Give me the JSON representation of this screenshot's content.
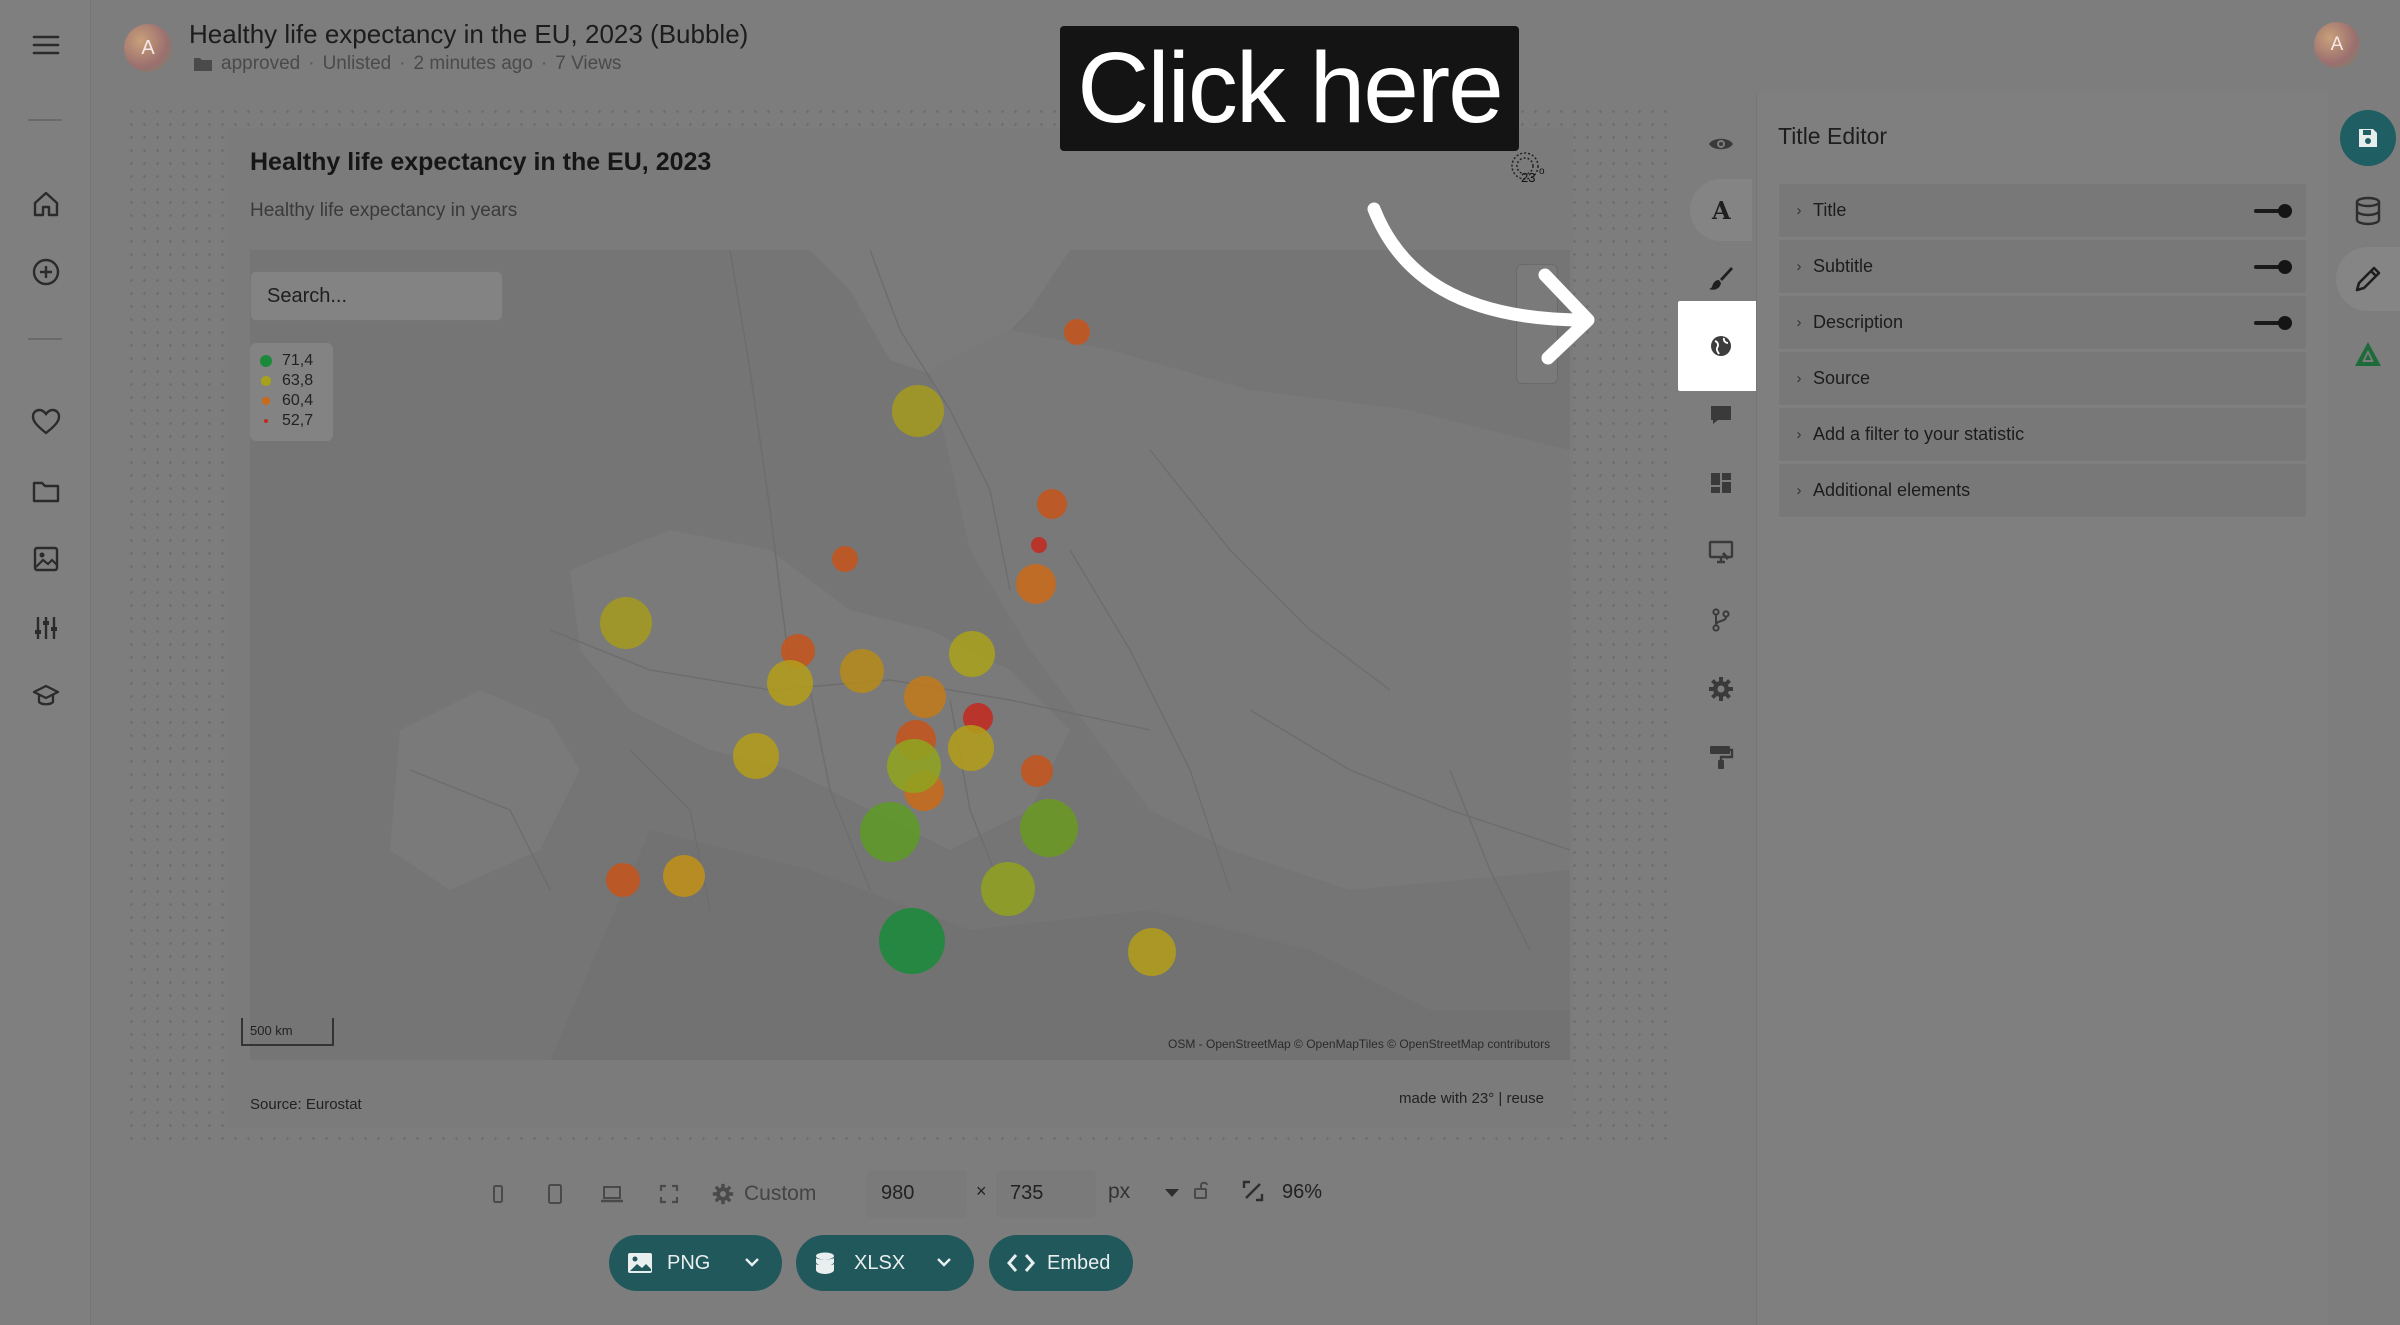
{
  "header": {
    "avatar_initial": "A",
    "title": "Healthy life expectancy in the EU, 2023 (Bubble)",
    "status": "approved",
    "visibility": "Unlisted",
    "modified": "2 minutes ago",
    "views": "7 Views"
  },
  "user": {
    "avatar_initial": "A"
  },
  "overlay": {
    "click_here": "Click here"
  },
  "chart": {
    "title": "Healthy life expectancy in the EU, 2023",
    "subtitle": "Healthy life expectancy in years",
    "search_placeholder": "Search...",
    "legend": [
      {
        "label": "71,4",
        "color": "#1a8a3a",
        "size": 16
      },
      {
        "label": "63,8",
        "color": "#a7a21a",
        "size": 13
      },
      {
        "label": "60,4",
        "color": "#c86a1a",
        "size": 10
      },
      {
        "label": "52,7",
        "color": "#c12a20",
        "size": 6
      }
    ],
    "scale_label": "500 km",
    "attribution": "OSM - OpenStreetMap   © OpenMapTiles © OpenStreetMap contributors",
    "source": "Source: Eurostat",
    "made_with": "made with 23° | reuse"
  },
  "panel": {
    "title": "Title Editor",
    "sections": [
      {
        "label": "Title",
        "toggle": true
      },
      {
        "label": "Subtitle",
        "toggle": true
      },
      {
        "label": "Description",
        "toggle": true
      },
      {
        "label": "Source",
        "toggle": false
      },
      {
        "label": "Add a filter to your statistic",
        "toggle": false
      },
      {
        "label": "Additional elements",
        "toggle": false
      }
    ]
  },
  "toolbar": {
    "icons": [
      "eye-icon",
      "text-format-icon",
      "brush-icon",
      "globe-icon",
      "comment-icon",
      "layout-icon",
      "monitor-icon",
      "branch-icon",
      "gear-icon",
      "paint-roller-icon"
    ]
  },
  "bottom": {
    "preset": "Custom",
    "width": "980",
    "height": "735",
    "times": "×",
    "unit": "px",
    "zoom": "96%",
    "export_png": "PNG",
    "export_xlsx": "XLSX",
    "embed": "Embed"
  },
  "colors": {
    "accent": "#21585c",
    "save_button": "#1f5e62",
    "high": "#1a8a3a",
    "mid_high": "#a7a21a",
    "mid_low": "#c86a1a",
    "low": "#c12a20"
  }
}
